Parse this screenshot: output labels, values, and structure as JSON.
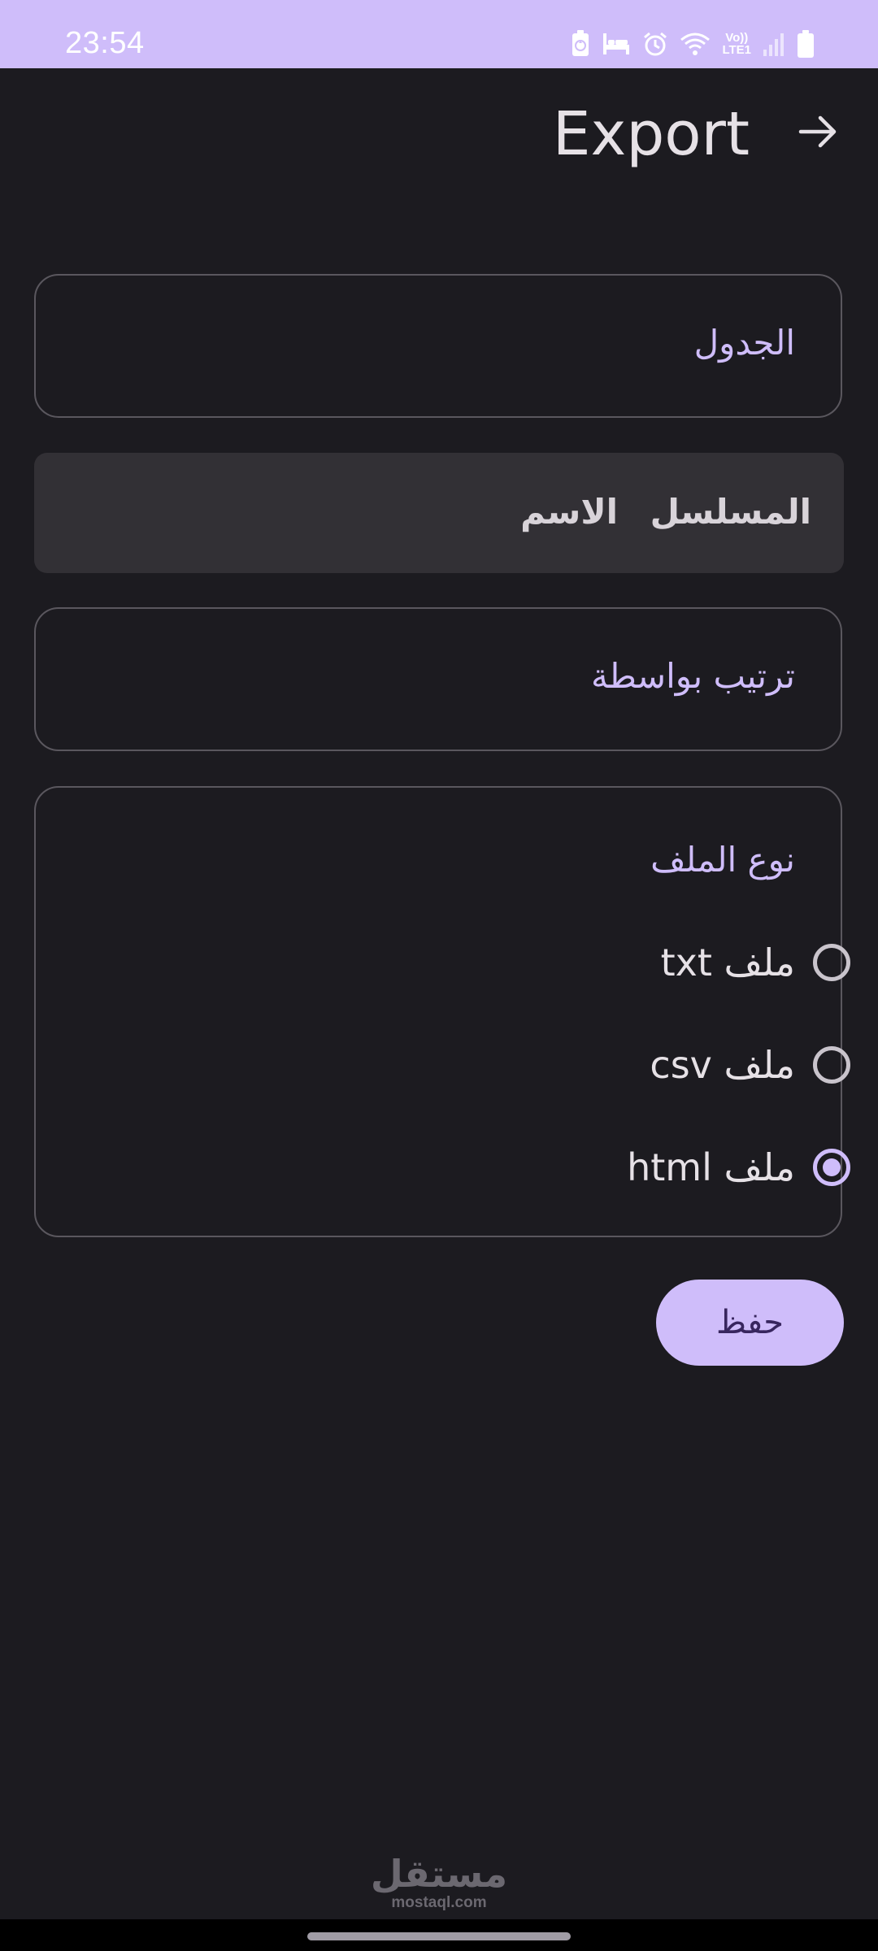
{
  "status_bar": {
    "time": "23:54",
    "volte_top": "Vo))",
    "volte_bottom": "LTE1",
    "icons": [
      "battery-saver-icon",
      "bed-icon",
      "alarm-icon",
      "wifi-icon",
      "volte-icon",
      "signal-icon",
      "battery-icon"
    ],
    "background": "#cfbdfa"
  },
  "header": {
    "title": "Export",
    "back_icon": "arrow-right-icon"
  },
  "table_field": {
    "label": "الجدول"
  },
  "columns": [
    {
      "label": "المسلسل"
    },
    {
      "label": "الاسم"
    }
  ],
  "sort_field": {
    "label": "ترتيب بواسطة"
  },
  "file_type": {
    "label": "نوع الملف",
    "options": [
      {
        "label": "ملف txt",
        "selected": false
      },
      {
        "label": "ملف csv",
        "selected": false
      },
      {
        "label": "ملف html",
        "selected": true
      }
    ]
  },
  "save_button": {
    "label": "حفظ"
  },
  "watermark": {
    "arabic": "مستقل",
    "latin": "mostaql.com"
  },
  "colors": {
    "accent": "#cfbdfa",
    "background": "#1c1b20",
    "surface": "#323035",
    "outline": "#5a575e",
    "on_accent": "#38265e"
  }
}
